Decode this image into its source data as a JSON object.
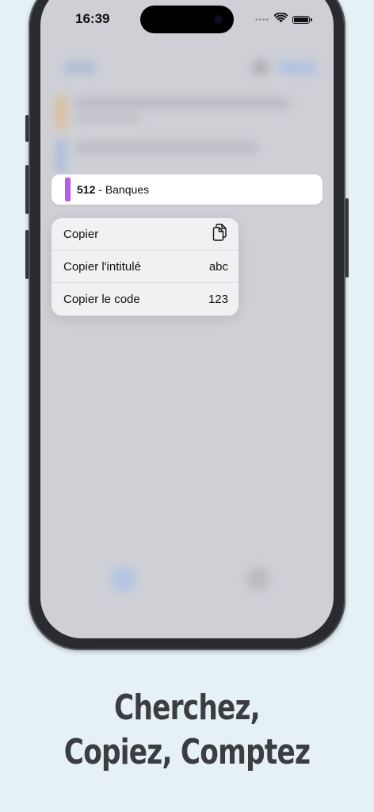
{
  "status_bar": {
    "time": "16:39",
    "signal": "••••"
  },
  "preview": {
    "code": "512",
    "separator": " - ",
    "label": "Banques",
    "accent_color": "#b55be6"
  },
  "context_menu": {
    "items": [
      {
        "label": "Copier",
        "icon": "copy-documents-icon"
      },
      {
        "label": "Copier l'intitulé",
        "meta": "abc"
      },
      {
        "label": "Copier le code",
        "meta": "123"
      }
    ]
  },
  "tagline": {
    "line1": "Cherchez,",
    "line2": "Copiez, Comptez"
  }
}
